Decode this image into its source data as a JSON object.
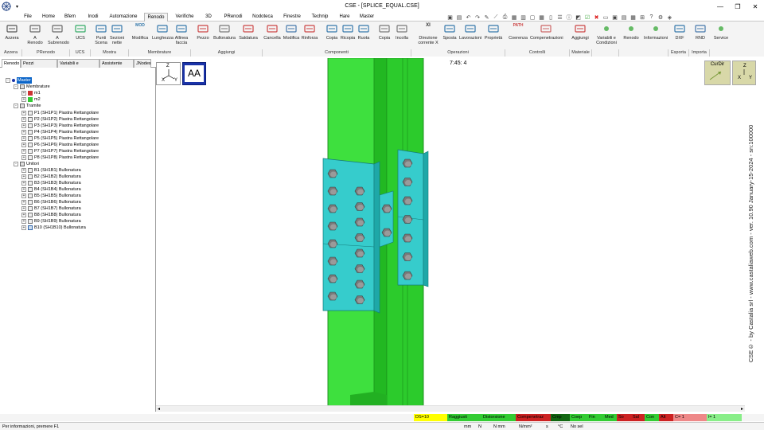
{
  "window": {
    "title": "CSE - [SPLICE_EQUAL.CSE]",
    "minimize": "—",
    "restore": "❐",
    "close": "✕"
  },
  "menu": {
    "tabs": [
      "File",
      "Home",
      "Bfem",
      "Inodi",
      "Automazione",
      "Renodo",
      "Verifiche",
      "3D",
      "PRenodi",
      "Nodoteca",
      "Finestre",
      "Technip",
      "Hare",
      "Master"
    ],
    "active": "Renodo"
  },
  "ribbon": {
    "buttons": [
      {
        "label": "Azzera"
      },
      {
        "label": "A\nRenodo"
      },
      {
        "label": "A\nSubrenodo"
      },
      {
        "label": "UCS"
      },
      {
        "label": "Punti\nScena"
      },
      {
        "label": "Sezioni\nnette"
      },
      {
        "label": "Modifica"
      },
      {
        "label": "Lunghezza"
      },
      {
        "label": "Allinea\nfaccia"
      },
      {
        "label": "Pezzo"
      },
      {
        "label": "Bullonatura"
      },
      {
        "label": "Saldatura"
      },
      {
        "label": "Cancella"
      },
      {
        "label": "Modifica"
      },
      {
        "label": "Rinforza"
      },
      {
        "label": "Copia"
      },
      {
        "label": "Ricopia"
      },
      {
        "label": "Ruota"
      },
      {
        "label": "Copia"
      },
      {
        "label": "Incolla"
      },
      {
        "label": "Direzione\ncorrente X"
      },
      {
        "label": "Sposta"
      },
      {
        "label": "Lavorazioni"
      },
      {
        "label": "Proprietà"
      },
      {
        "label": "Coerenza"
      },
      {
        "label": "Compenetrazioni"
      },
      {
        "label": "Aggiungi"
      },
      {
        "label": "Variabili e\nCondizioni"
      },
      {
        "label": "Renodo"
      },
      {
        "label": "Informazioni"
      },
      {
        "label": "DXF"
      },
      {
        "label": "RND"
      },
      {
        "label": "Service"
      }
    ],
    "groups": [
      "Azzera",
      "PRenodo",
      "UCS",
      "Mostra",
      "Membrature",
      "Aggiungi",
      "Componenti",
      "Operazioni",
      "Controlli",
      "Materiale",
      "",
      "",
      "Esporta",
      "Importa"
    ],
    "icon_texts": {
      "mod": "MOD",
      "path": "PATH",
      "xi": "XI"
    }
  },
  "left_tabs": [
    "Renodo",
    "Pezzi selezionati",
    "Variabili e condizioni",
    "Assistente",
    "JNodes"
  ],
  "tree": [
    {
      "label": "Master",
      "level": 0,
      "selected": true,
      "exp": "-"
    },
    {
      "label": "Membrature",
      "level": 1,
      "exp": "-"
    },
    {
      "label": "m1",
      "level": 2,
      "exp": "+"
    },
    {
      "label": "m2",
      "level": 2,
      "exp": "+"
    },
    {
      "label": "Tramite",
      "level": 1,
      "exp": "-"
    },
    {
      "label": "P1 (SH1P1)  Piastra Rettangolare",
      "level": 2,
      "exp": "+"
    },
    {
      "label": "P2 (SH1P2)  Piastra Rettangolare",
      "level": 2,
      "exp": "+"
    },
    {
      "label": "P3 (SH1P3)  Piastra Rettangolare",
      "level": 2,
      "exp": "+"
    },
    {
      "label": "P4 (SH1P4)  Piastra Rettangolare",
      "level": 2,
      "exp": "+"
    },
    {
      "label": "P5 (SH1P5)  Piastra Rettangolare",
      "level": 2,
      "exp": "+"
    },
    {
      "label": "P6 (SH1P6)  Piastra Rettangolare",
      "level": 2,
      "exp": "+"
    },
    {
      "label": "P7 (SH1P7)  Piastra Rettangolare",
      "level": 2,
      "exp": "+"
    },
    {
      "label": "P8 (SH1P8)  Piastra Rettangolare",
      "level": 2,
      "exp": "+"
    },
    {
      "label": "Unitori",
      "level": 1,
      "exp": "-"
    },
    {
      "label": "B1 (SH1B1)  Bullonatura",
      "level": 2,
      "exp": "+"
    },
    {
      "label": "B2 (SH1B2)  Bullonatura",
      "level": 2,
      "exp": "+"
    },
    {
      "label": "B3 (SH1B3)  Bullonatura",
      "level": 2,
      "exp": "+"
    },
    {
      "label": "B4 (SH1B4)  Bullonatura",
      "level": 2,
      "exp": "+"
    },
    {
      "label": "B5 (SH1B5)  Bullonatura",
      "level": 2,
      "exp": "+"
    },
    {
      "label": "B6 (SH1B6)  Bullonatura",
      "level": 2,
      "exp": "+"
    },
    {
      "label": "B7 (SH1B7)  Bullonatura",
      "level": 2,
      "exp": "+"
    },
    {
      "label": "B8 (SH1B8)  Bullonatura",
      "level": 2,
      "exp": "+"
    },
    {
      "label": "B9 (SH1B9)  Bullonatura",
      "level": 2,
      "exp": "+"
    },
    {
      "label": "B10 (SH1B10)  Bullonatura",
      "level": 2,
      "exp": "+"
    }
  ],
  "viewport": {
    "aa_label": "AA",
    "timer": "7:45: 4",
    "curdir": "CurDir",
    "axis": {
      "z": "Z",
      "x": "X",
      "y": "Y"
    },
    "side_text": "CSE© - by Castalia srl - www.castaliaweb.com - ver. 10.90 January-15-2024 - sn:100000"
  },
  "status": {
    "cells": [
      {
        "text": "DS=10",
        "color": "#ffff00"
      },
      {
        "text": "Raggiusti",
        "color": "#33cc33"
      },
      {
        "text": "Distorsione",
        "color": "#33cc33"
      },
      {
        "text": "Compenetraz",
        "color": "#cc2222"
      },
      {
        "text": "Cmp",
        "color": "#116611"
      },
      {
        "text": "Coep",
        "color": "#33cc33"
      },
      {
        "text": "Fin",
        "color": "#33cc33"
      },
      {
        "text": "Med",
        "color": "#33cc33"
      },
      {
        "text": "So",
        "color": "#cc2222"
      },
      {
        "text": "Sal",
        "color": "#cc2222"
      },
      {
        "text": "Con",
        "color": "#33cc33"
      },
      {
        "text": "Alt",
        "color": "#cc2222"
      },
      {
        "text": "C= 1",
        "color": "#ee8888"
      },
      {
        "text": "l= 1",
        "color": "#88ee88"
      }
    ],
    "hint": "Per informazioni, premere F1",
    "units": [
      "mm",
      "N",
      "N mm",
      "N/mm²",
      "s",
      "°C",
      "No sel"
    ]
  }
}
